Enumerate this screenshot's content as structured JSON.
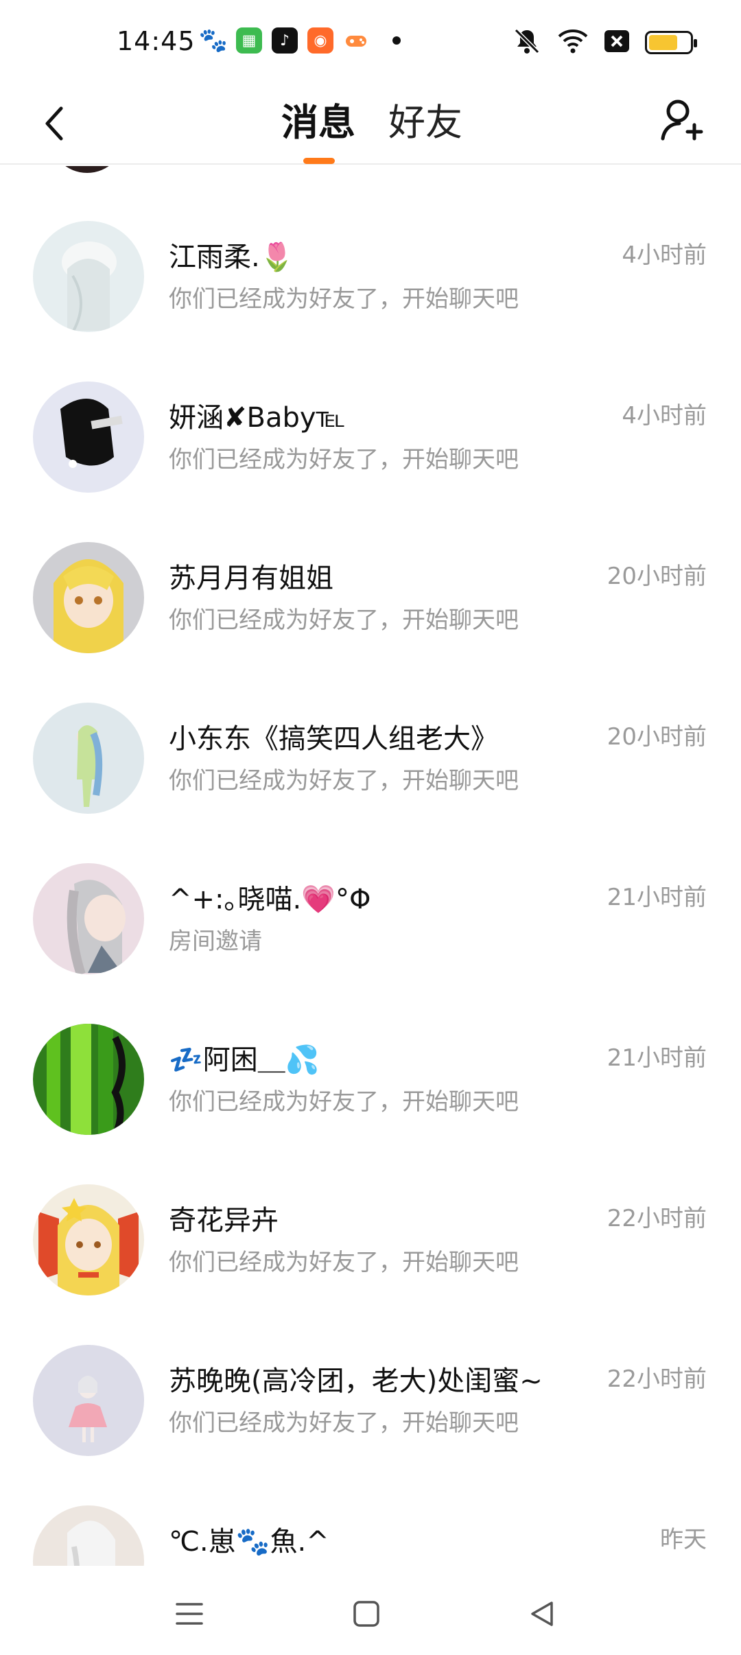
{
  "status_bar": {
    "time": "14:45",
    "notification_icons": [
      "baidu-icon",
      "green-app-icon",
      "douyin-icon",
      "kuaishou-icon",
      "game-icon",
      "more-dot-icon"
    ],
    "right_icons": [
      "mute-icon",
      "wifi-icon",
      "sim-off-icon",
      "battery-icon"
    ],
    "battery_level": 0.7,
    "battery_color": "#f7c531"
  },
  "header": {
    "tab_messages": "消息",
    "tab_friends": "好友",
    "accent": "#ff7a1a"
  },
  "conversations": [
    {
      "name": "江雨柔.🌷",
      "preview": "你们已经成为好友了，开始聊天吧",
      "time": "4小时前"
    },
    {
      "name": "妍涵✘Baby℡",
      "preview": "你们已经成为好友了，开始聊天吧",
      "time": "4小时前"
    },
    {
      "name": "苏月月有姐姐",
      "preview": "你们已经成为好友了，开始聊天吧",
      "time": "20小时前"
    },
    {
      "name": "小东东《搞笑四人组老大》",
      "preview": "你们已经成为好友了，开始聊天吧",
      "time": "20小时前"
    },
    {
      "name": "^+:｡晓喵.💗°Φ",
      "preview": "房间邀请",
      "time": "21小时前"
    },
    {
      "name": "💤阿困＿💦",
      "preview": "你们已经成为好友了，开始聊天吧",
      "time": "21小时前"
    },
    {
      "name": "奇花异卉",
      "preview": "你们已经成为好友了，开始聊天吧",
      "time": "22小时前"
    },
    {
      "name": "苏晚晚(高冷团，老大)处闺蜜~",
      "preview": "你们已经成为好友了，开始聊天吧",
      "time": "22小时前"
    },
    {
      "name": "℃.崽🐾魚.^",
      "preview": "",
      "time": "昨天"
    }
  ]
}
